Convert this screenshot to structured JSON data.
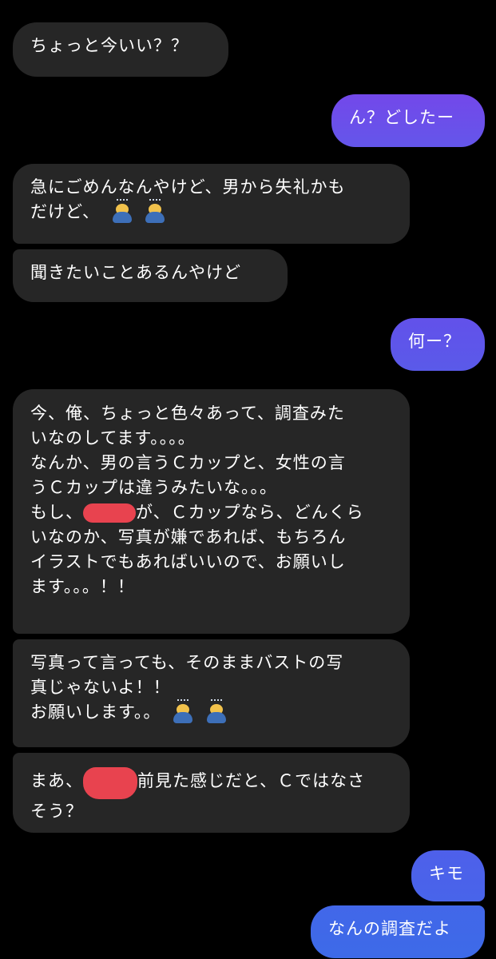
{
  "colors": {
    "background": "#000000",
    "incoming_bubble": "#262626",
    "outgoing_gradient_top": "#6a4dea",
    "outgoing_gradient_bottom": "#3d68e8",
    "text": "#ffffff",
    "redaction": "#e8434f"
  },
  "messages": [
    {
      "direction": "incoming",
      "lines": [
        "ちょっと今いい？？"
      ]
    },
    {
      "direction": "outgoing",
      "lines": [
        "ん？どしたー"
      ]
    },
    {
      "direction": "incoming",
      "lines": [
        "急にごめんなんやけど、男から失礼かも",
        "だけど、"
      ],
      "emoji": [
        "person-bowing-emoji",
        "person-bowing-emoji"
      ]
    },
    {
      "direction": "incoming",
      "lines": [
        "聞きたいことあるんやけど"
      ]
    },
    {
      "direction": "outgoing",
      "lines": [
        "何ー？"
      ]
    },
    {
      "direction": "incoming",
      "lines": [
        "今、俺、ちょっと色々あって、調査みた",
        "いなのしてます。。。。",
        "なんか、男の言うＣカップと、女性の言",
        "うＣカップは違うみたいな。。。",
        "もし、",
        "が、Ｃカップなら、どんくら",
        "いなのか、写真が嫌であれば、もちろん",
        "イラストでもあればいいので、お願いし",
        "ます。。。！！"
      ]
    },
    {
      "direction": "incoming",
      "lines": [
        "写真って言っても、そのままバストの写",
        "真じゃないよ！！",
        "お願いします。。"
      ],
      "emoji": [
        "person-bowing-emoji",
        "person-bowing-emoji"
      ]
    },
    {
      "direction": "incoming",
      "lines": [
        "まあ、",
        "前見た感じだと、Ｃではなさ",
        "そう？"
      ]
    },
    {
      "direction": "outgoing",
      "lines": [
        "キモ"
      ]
    },
    {
      "direction": "outgoing",
      "lines": [
        "なんの調査だよ"
      ]
    }
  ]
}
